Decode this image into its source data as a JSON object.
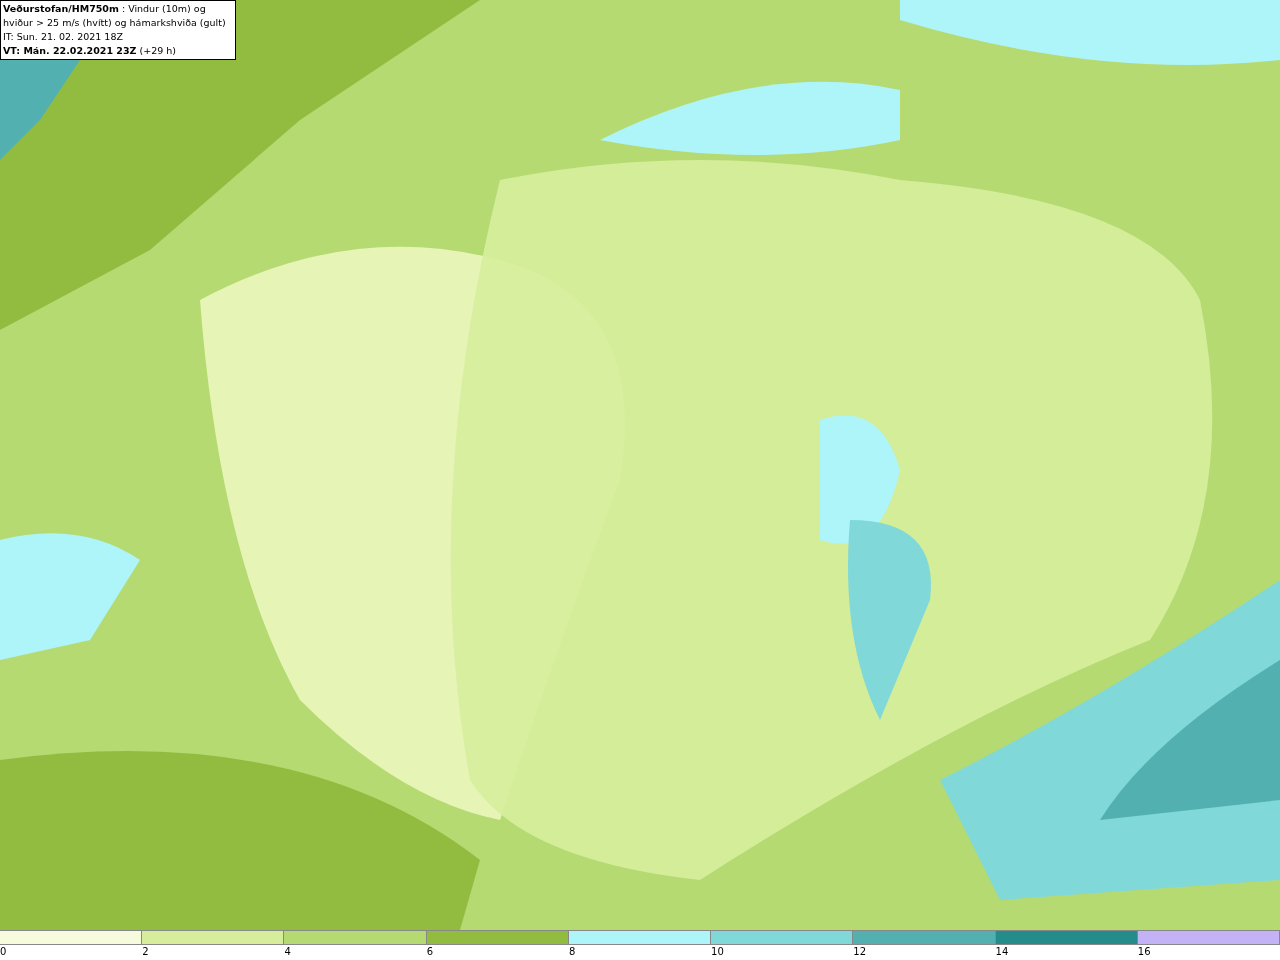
{
  "title_box": {
    "lines": [
      "**Veðurstofan/HM750m** : Vindur (10m) og",
      "hviður > 25 m/s (hvítt) og hámarkshviða (gult)",
      "IT: Sun. 21. 02. 2021 18Z",
      "**VT: Mán. 22.02.2021 23Z** (+29 h)"
    ]
  },
  "legend": {
    "segments": [
      {
        "color": "#f5fbdc"
      },
      {
        "color": "#d6ee9c"
      },
      {
        "color": "#b6da72"
      },
      {
        "color": "#92bc40"
      },
      {
        "color": "#aef5fa"
      },
      {
        "color": "#80d8d8"
      },
      {
        "color": "#52b0b0"
      },
      {
        "color": "#258c8c"
      },
      {
        "color": "#c3b2f5"
      }
    ],
    "ticks": [
      "0",
      "2",
      "4",
      "6",
      "8",
      "10",
      "12",
      "14",
      "16"
    ]
  }
}
